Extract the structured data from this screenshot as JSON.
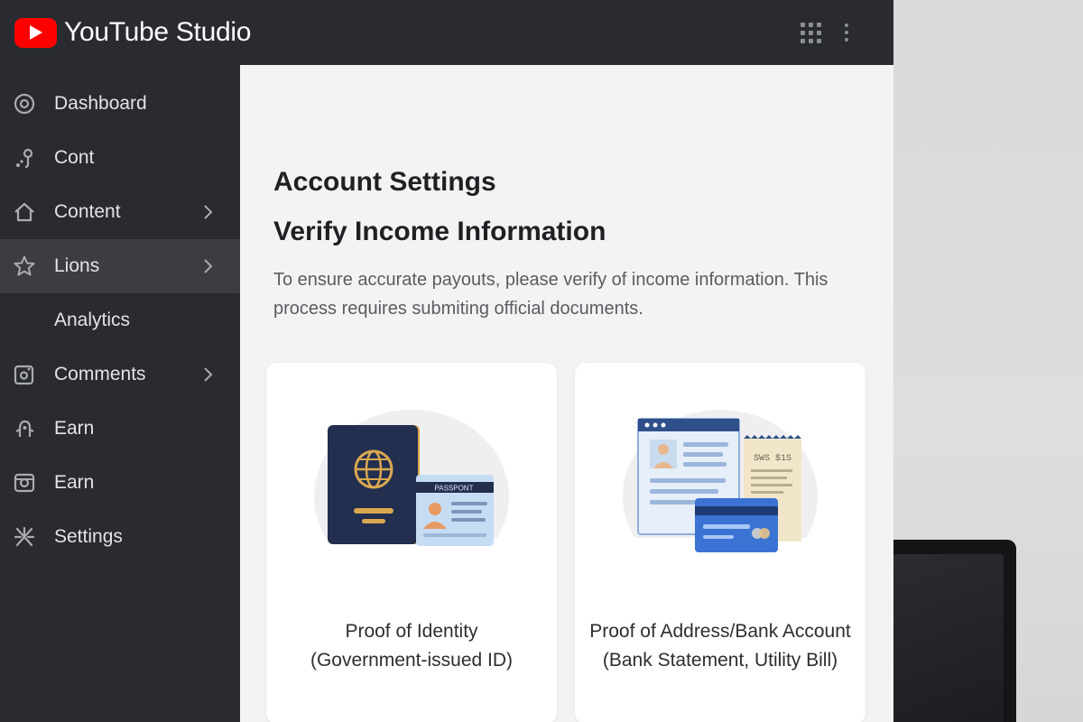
{
  "app": {
    "title": "YouTube Studio"
  },
  "header": {
    "icons": [
      "apps-grid-icon",
      "more-vert-icon"
    ]
  },
  "sidebar": {
    "items": [
      {
        "label": "Dashboard",
        "icon": "dashboard-icon",
        "chevron": false,
        "active": false
      },
      {
        "label": "Cont",
        "icon": "cont-icon",
        "chevron": false,
        "active": false
      },
      {
        "label": "Content",
        "icon": "home-icon",
        "chevron": true,
        "active": false
      },
      {
        "label": "Lions",
        "icon": "star-icon",
        "chevron": true,
        "active": true
      },
      {
        "label": "Analytics",
        "icon": "",
        "chevron": false,
        "active": false
      },
      {
        "label": "Comments",
        "icon": "comments-icon",
        "chevron": true,
        "active": false
      },
      {
        "label": "Earn",
        "icon": "earn-icon",
        "chevron": false,
        "active": false
      },
      {
        "label": "Earn",
        "icon": "earn-camera-icon",
        "chevron": false,
        "active": false
      },
      {
        "label": "Settings",
        "icon": "settings-icon",
        "chevron": false,
        "active": false
      }
    ]
  },
  "main": {
    "page_title": "Account Settings",
    "section_title": "Verify Income Information",
    "description": "To ensure accurate payouts, please verify of income information. This process requires submiting official documents.",
    "cards": [
      {
        "line1": "Proof of Identity",
        "line2": "(Government-issued ID)",
        "illustration": "passport-icon",
        "passport_label": "PASSPONT"
      },
      {
        "line1": "Proof of Address/Bank Account",
        "line2": "(Bank Statement, Utility Bill)",
        "illustration": "bank-documents-icon",
        "receipt_text": "SWS $1S"
      }
    ]
  },
  "colors": {
    "brand_red": "#ff0000",
    "sidebar_bg": "#292b30",
    "active_item_bg": "#3b3d42",
    "main_bg": "#f3f3f4"
  }
}
